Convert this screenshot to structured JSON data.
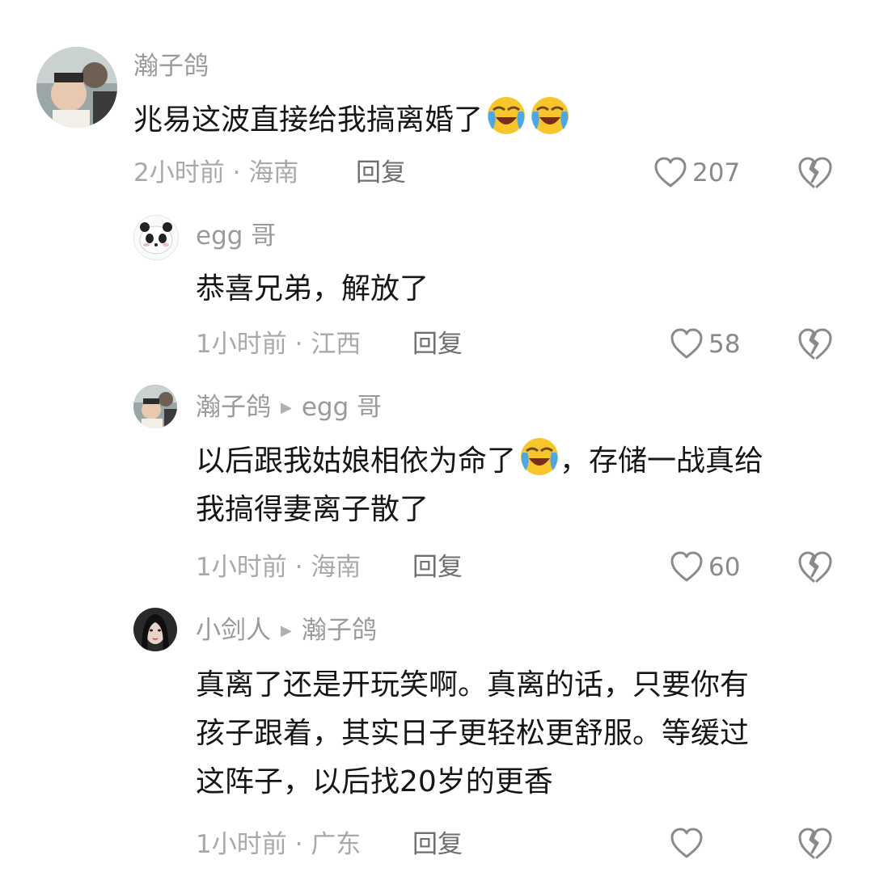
{
  "comments": [
    {
      "username": "瀚子鸽",
      "text": "兆易这波直接给我搞离婚了",
      "emojis": [
        "crying-laughing",
        "crying-laughing"
      ],
      "time": "2小时前",
      "sep": "·",
      "location": "海南",
      "reply_label": "回复",
      "likes": "207"
    },
    {
      "username": "egg 哥",
      "text": "恭喜兄弟，解放了",
      "time": "1小时前",
      "sep": "·",
      "location": "江西",
      "reply_label": "回复",
      "likes": "58"
    },
    {
      "username": "瀚子鸽",
      "reply_to": "egg 哥",
      "text_before": "以后跟我姑娘相依为命了",
      "emoji": "crying-laughing",
      "text_after": "，存储一战真给",
      "text_line2": "我搞得妻离子散了",
      "time": "1小时前",
      "sep": "·",
      "location": "海南",
      "reply_label": "回复",
      "likes": "60"
    },
    {
      "username": "小剑人",
      "reply_to": "瀚子鸽",
      "lines": [
        "真离了还是开玩笑啊。真离的话，只要你有",
        "孩子跟着，其实日子更轻松更舒服。等缓过",
        "这阵子，以后找20岁的更香"
      ],
      "time": "1小时前",
      "sep": "·",
      "location": "广东",
      "reply_label": "回复"
    }
  ],
  "colors": {
    "text": "#161616",
    "meta": "#a9a9a9",
    "icon": "#8a8a8a"
  }
}
